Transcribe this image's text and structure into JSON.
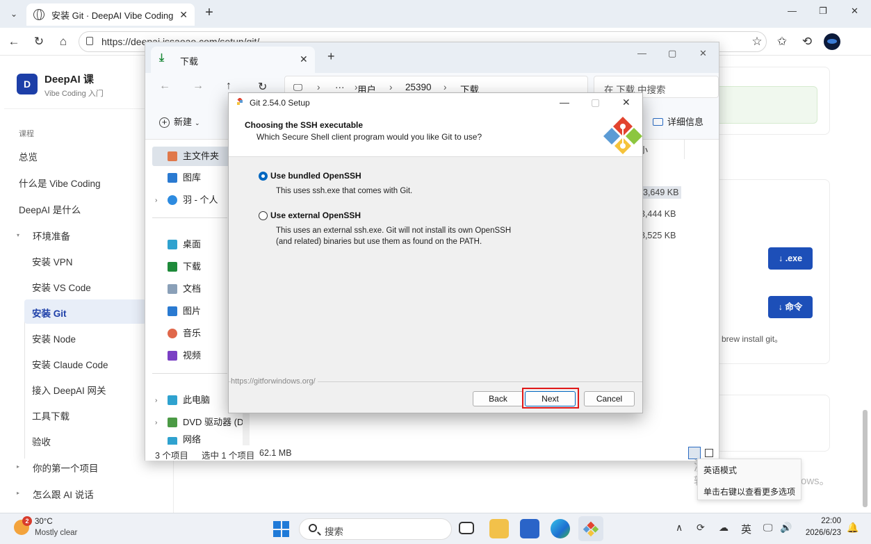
{
  "browser": {
    "tab_title": "安装 Git · DeepAI Vibe Coding 课",
    "url": "https://deepai.jssaoao.com/setup/git/"
  },
  "site": {
    "logo_letter": "D",
    "brand": "DeepAI 课",
    "brand_sub": "Vibe Coding 入门",
    "section_label": "课程",
    "nav": {
      "overview": "总览",
      "what_vibe": "什么是 Vibe Coding",
      "what_deepai": "DeepAI 是什么",
      "env": "环境准备",
      "vpn": "安装 VPN",
      "vscode": "安装 VS Code",
      "git": "安装 Git",
      "node": "安装 Node",
      "claude": "安装 Claude Code",
      "gateway": "接入 DeepAI 网关",
      "tools": "工具下载",
      "accept": "验收",
      "first_project": "你的第一个项目",
      "talk_ai": "怎么跟 AI 说话"
    },
    "download_exe": "↓ .exe",
    "download_cmd": "↓ 命令",
    "brew_text": "brew install git。"
  },
  "explorer": {
    "tab_title": "下载",
    "breadcrumb": [
      "用户",
      "25390",
      "下载"
    ],
    "search_placeholder": "在 下载 中搜索",
    "new_label": "新建",
    "details_label": "详细信息",
    "col_header_partial": "小",
    "sidebar": {
      "home": "主文件夹",
      "gallery": "图库",
      "onedrive": "羽 - 个人",
      "desktop": "桌面",
      "downloads": "下载",
      "documents": "文档",
      "pictures": "图片",
      "music": "音乐",
      "videos": "视频",
      "thispc": "此电脑",
      "dvd": "DVD 驱动器 (D",
      "network": "网络"
    },
    "sizes": [
      "3,649 KB",
      "3,444 KB",
      "8,525 KB"
    ],
    "status": {
      "count": "3 个项目",
      "selected": "选中 1 个项目",
      "size": "62.1 MB"
    }
  },
  "dialog": {
    "title": "Git 2.54.0 Setup",
    "heading": "Choosing the SSH executable",
    "subheading": "Which Secure Shell client program would you like Git to use?",
    "option1_label": "Use bundled OpenSSH",
    "option1_desc": "This uses ssh.exe that comes with Git.",
    "option2_label": "Use external OpenSSH",
    "option2_desc1": "This uses an external ssh.exe. Git will not install its own OpenSSH",
    "option2_desc2": "(and related) binaries but use them as found on the PATH.",
    "footer_url": "https://gitforwindows.org/",
    "back": "Back",
    "next": "Next",
    "cancel": "Cancel",
    "selected_option": "Use bundled OpenSSH"
  },
  "overlay": {
    "activate1": "激活 Windows",
    "activate2": "转到\"设置\"以激活 Windows。",
    "ime_line1": "英语模式",
    "ime_line2": "单击右键以查看更多选项"
  },
  "taskbar": {
    "badge": "2",
    "temp": "30°C",
    "condition": "Mostly clear",
    "search": "搜索",
    "ime": "英",
    "time": "22:00",
    "date": "2026/6/23"
  },
  "colors": {
    "accent_blue": "#1d4fb8",
    "highlight_red": "#e01818",
    "radio_blue": "#0067c0"
  }
}
